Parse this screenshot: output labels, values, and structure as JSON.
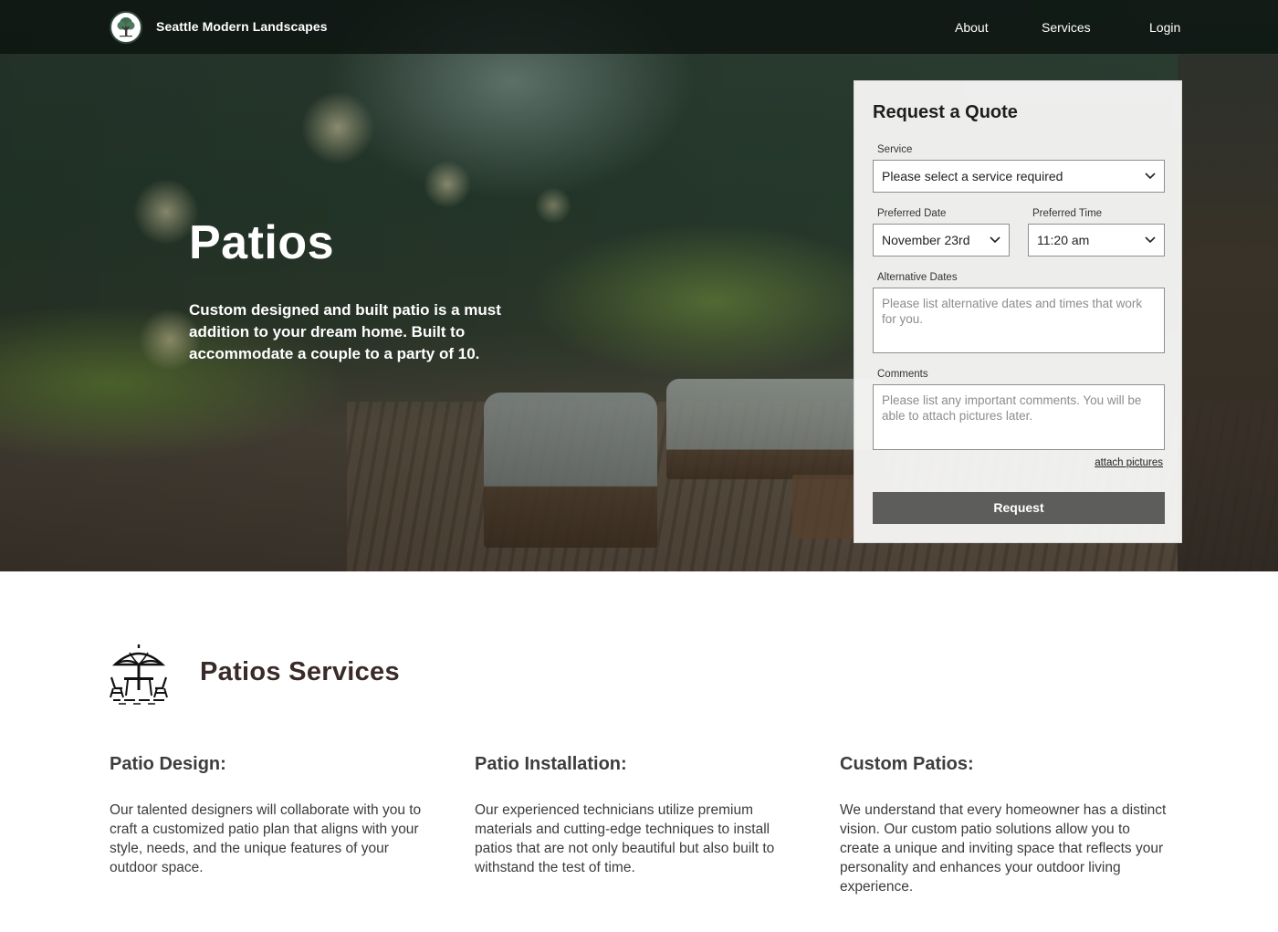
{
  "nav": {
    "brand": "Seattle Modern Landscapes",
    "logo_icon": "tree-icon",
    "links": [
      "About",
      "Services",
      "Login"
    ]
  },
  "hero": {
    "title": "Patios",
    "description": "Custom designed and built patio is a must addition to your dream home. Built to accommodate a couple to a party of 10."
  },
  "quote_form": {
    "title": "Request a Quote",
    "service_label": "Service",
    "service_value": "Please select a service required",
    "date_label": "Preferred Date",
    "date_value": "November 23rd",
    "time_label": "Preferred Time",
    "time_value": "11:20 am",
    "alt_dates_label": "Alternative Dates",
    "alt_dates_placeholder": "Please list alternative dates and times that work for you.",
    "comments_label": "Comments",
    "comments_placeholder": "Please list any important comments. You will be able to attach pictures later.",
    "attach_link": "attach pictures",
    "submit": "Request"
  },
  "services": {
    "icon": "patio-umbrella-table-icon",
    "title": "Patios Services",
    "items": [
      {
        "heading": "Patio Design:",
        "text": "Our talented designers will collaborate with you to craft a customized patio plan that aligns with your style, needs, and the unique features of your outdoor space."
      },
      {
        "heading": "Patio Installation:",
        "text": "Our experienced technicians utilize premium materials and cutting-edge techniques to install patios that are not only beautiful but also built to withstand the test of time."
      },
      {
        "heading": "Custom Patios:",
        "text": "We understand that every homeowner has a distinct vision. Our custom patio solutions allow you to create a unique and inviting space that reflects your personality and enhances your outdoor living experience."
      }
    ]
  }
}
